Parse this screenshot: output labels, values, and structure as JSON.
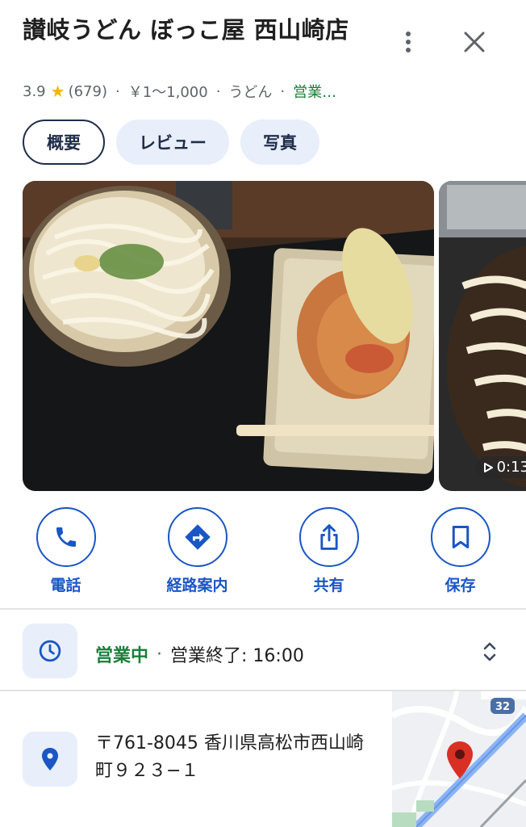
{
  "place": {
    "name": "讃岐うどん ぼっこ屋 西山崎店",
    "rating": "3.9",
    "review_count": "(679)",
    "price": "￥1〜1,000",
    "category": "うどん",
    "status": "営業…"
  },
  "meta_separators": {
    "dot": "·"
  },
  "tabs": [
    {
      "label": "概要",
      "active": true
    },
    {
      "label": "レビュー",
      "active": false
    },
    {
      "label": "写真",
      "active": false
    }
  ],
  "photos": {
    "video_duration": "0:13"
  },
  "actions": [
    {
      "label": "電話",
      "icon": "phone-icon"
    },
    {
      "label": "経路案内",
      "icon": "directions-icon"
    },
    {
      "label": "共有",
      "icon": "share-icon"
    },
    {
      "label": "保存",
      "icon": "bookmark-icon"
    }
  ],
  "hours": {
    "status": "営業中",
    "separator": "·",
    "closing": "営業終了: 16:00"
  },
  "address": {
    "text": "〒761-8045 香川県高松市西山崎町９２３−１",
    "map_route_label": "32"
  },
  "colors": {
    "accent": "#1a56c4",
    "open_green": "#188038",
    "chip_bg": "#e8eefa",
    "star": "#f5b400"
  }
}
